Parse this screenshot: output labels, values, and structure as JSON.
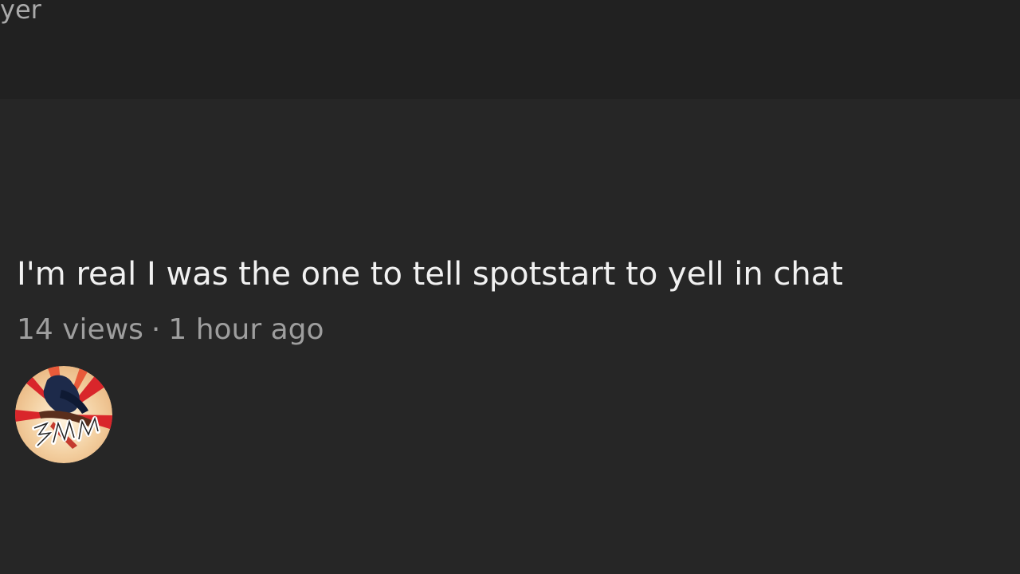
{
  "header": {
    "truncated_text": "yer"
  },
  "video": {
    "title": "I'm real I was the one to tell spotstart to yell in chat",
    "views": "14 views",
    "separator": "·",
    "time": "1 hour ago"
  },
  "channel": {
    "avatar_icon": "channel-avatar-art"
  }
}
